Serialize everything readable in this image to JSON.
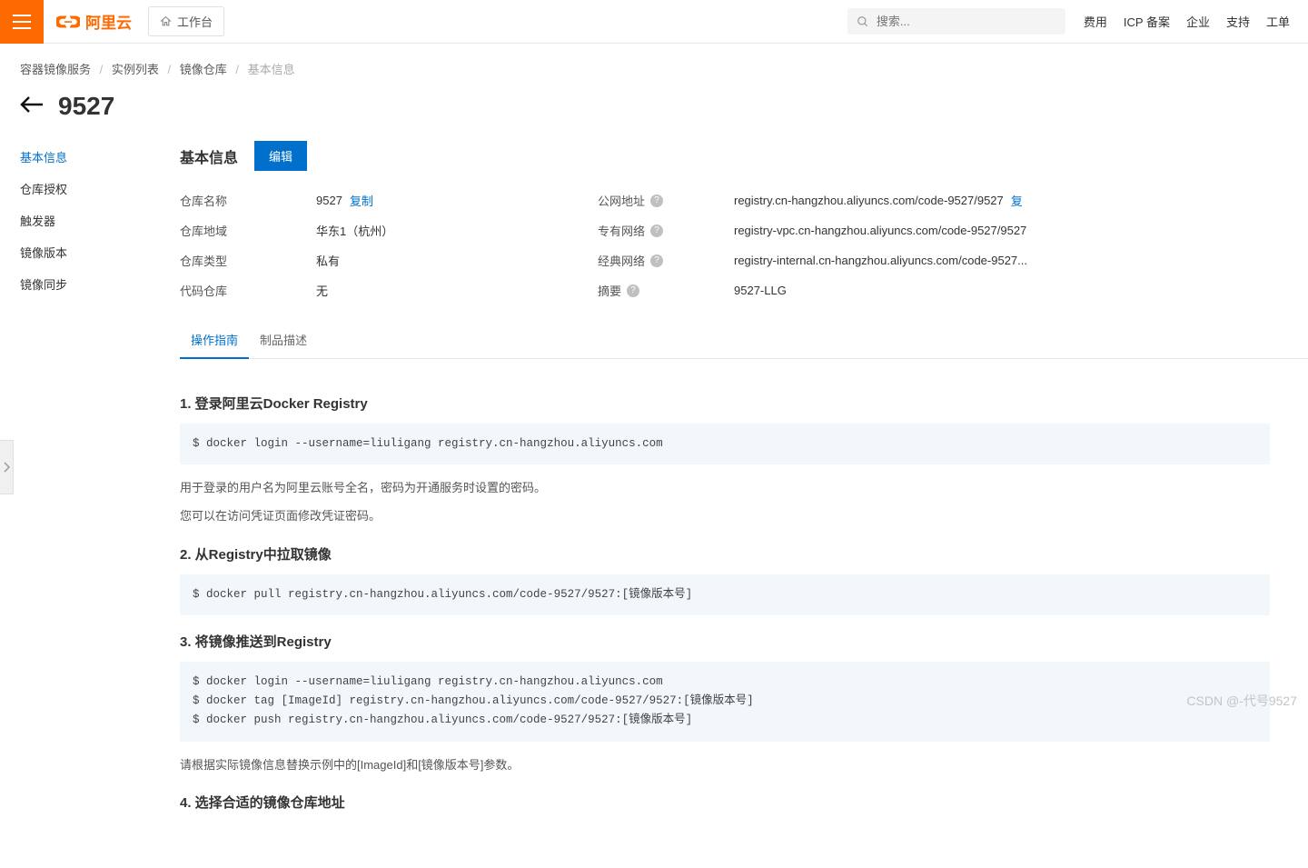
{
  "header": {
    "brand": "阿里云",
    "workbench": "工作台",
    "search_placeholder": "搜索...",
    "links": [
      "费用",
      "ICP 备案",
      "企业",
      "支持",
      "工单"
    ]
  },
  "breadcrumb": {
    "items": [
      "容器镜像服务",
      "实例列表",
      "镜像仓库"
    ],
    "current": "基本信息"
  },
  "page_title": "9527",
  "sidebar": {
    "items": [
      "基本信息",
      "仓库授权",
      "触发器",
      "镜像版本",
      "镜像同步"
    ],
    "active_index": 0
  },
  "section": {
    "title": "基本信息",
    "edit_label": "编辑"
  },
  "kv_left": [
    {
      "label": "仓库名称",
      "value": "9527",
      "copy": "复制"
    },
    {
      "label": "仓库地域",
      "value": "华东1（杭州）"
    },
    {
      "label": "仓库类型",
      "value": "私有"
    },
    {
      "label": "代码仓库",
      "value": "无"
    }
  ],
  "kv_right": [
    {
      "label": "公网地址",
      "help": true,
      "value": "registry.cn-hangzhou.aliyuncs.com/code-9527/9527",
      "copy": "复"
    },
    {
      "label": "专有网络",
      "help": true,
      "value": "registry-vpc.cn-hangzhou.aliyuncs.com/code-9527/9527"
    },
    {
      "label": "经典网络",
      "help": true,
      "value": "registry-internal.cn-hangzhou.aliyuncs.com/code-9527..."
    },
    {
      "label": "摘要",
      "help": true,
      "value": "9527-LLG"
    }
  ],
  "tabs": {
    "items": [
      "操作指南",
      "制品描述"
    ],
    "active_index": 0
  },
  "guide": {
    "s1_title": "1. 登录阿里云Docker Registry",
    "s1_code": "$ docker login --username=liuligang registry.cn-hangzhou.aliyuncs.com",
    "s1_p1": "用于登录的用户名为阿里云账号全名，密码为开通服务时设置的密码。",
    "s1_p2": "您可以在访问凭证页面修改凭证密码。",
    "s2_title": "2. 从Registry中拉取镜像",
    "s2_code": "$ docker pull registry.cn-hangzhou.aliyuncs.com/code-9527/9527:[镜像版本号]",
    "s3_title": "3. 将镜像推送到Registry",
    "s3_code": "$ docker login --username=liuligang registry.cn-hangzhou.aliyuncs.com\n$ docker tag [ImageId] registry.cn-hangzhou.aliyuncs.com/code-9527/9527:[镜像版本号]\n$ docker push registry.cn-hangzhou.aliyuncs.com/code-9527/9527:[镜像版本号]",
    "s3_p1": "请根据实际镜像信息替换示例中的[ImageId]和[镜像版本号]参数。",
    "s4_title": "4. 选择合适的镜像仓库地址"
  },
  "watermark": "CSDN @-代号9527"
}
